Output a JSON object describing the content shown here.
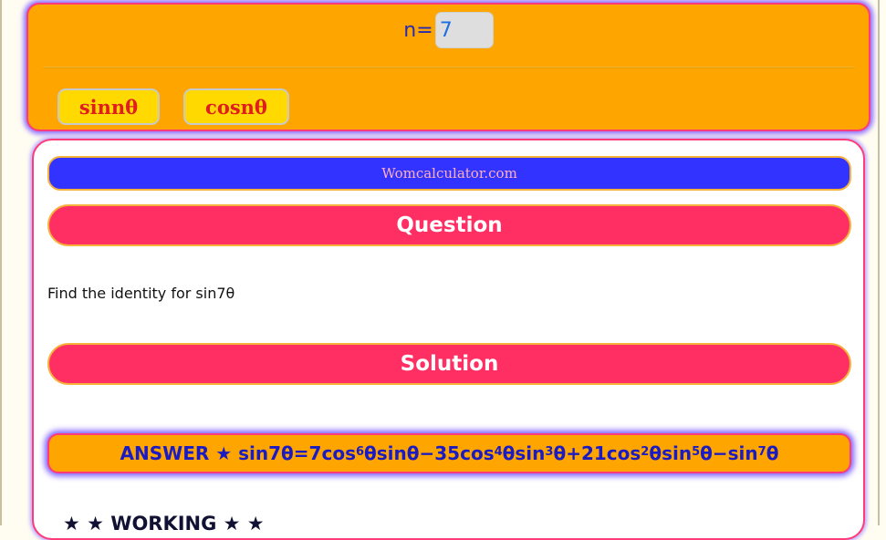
{
  "controls": {
    "n_label": "n=",
    "n_value": "7",
    "sin_button": "sinnθ",
    "cos_button": "cosnθ"
  },
  "card": {
    "brand": "Womcalculator.com",
    "question_heading": "Question",
    "question_text": "Find the identity for sin7θ",
    "solution_heading": "Solution",
    "answer": {
      "prefix": "ANSWER ★ sin7θ=7cos",
      "p1": "6",
      "t1": "θsinθ−35cos",
      "p2": "4",
      "t2": "θsin",
      "p3": "3",
      "t3": "θ+21cos",
      "p4": "2",
      "t4": "θsin",
      "p5": "5",
      "t5": "θ−sin",
      "p6": "7",
      "t6": "θ"
    },
    "working_heading": "★ ★ WORKING ★ ★"
  },
  "colors": {
    "panel_bg": "#ffa500",
    "brand_bar": "#3333ff",
    "heading_pill": "#ff2f63",
    "button_bg": "#ffd900",
    "button_text": "#e01e1e",
    "answer_text": "#1b1bc4"
  }
}
